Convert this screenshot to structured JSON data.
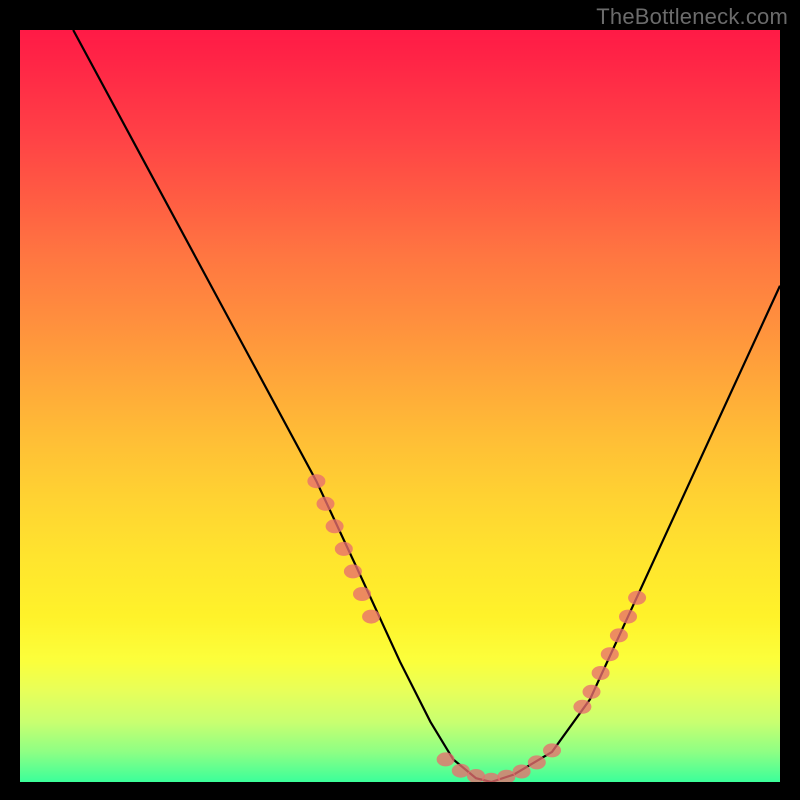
{
  "watermark": "TheBottleneck.com",
  "chart_data": {
    "type": "line",
    "title": "",
    "xlabel": "",
    "ylabel": "",
    "xlim": [
      0,
      100
    ],
    "ylim": [
      0,
      100
    ],
    "series": [
      {
        "name": "curve",
        "x": [
          7,
          15,
          23,
          31,
          39,
          45,
          50,
          54,
          57,
          60,
          62,
          65,
          70,
          75,
          80,
          85,
          90,
          95,
          100
        ],
        "y": [
          100,
          85,
          70,
          55,
          40,
          27,
          16,
          8,
          3,
          0.5,
          0,
          1,
          4,
          11,
          22,
          33,
          44,
          55,
          66
        ]
      },
      {
        "name": "markers-left",
        "x": [
          39,
          40.2,
          41.4,
          42.6,
          43.8,
          45,
          46.2
        ],
        "y": [
          40,
          37,
          34,
          31,
          28,
          25,
          22
        ]
      },
      {
        "name": "markers-bottom",
        "x": [
          56,
          58,
          60,
          62,
          64,
          66,
          68,
          70
        ],
        "y": [
          3,
          1.5,
          0.8,
          0.3,
          0.7,
          1.4,
          2.6,
          4.2
        ]
      },
      {
        "name": "markers-right",
        "x": [
          74,
          75.2,
          76.4,
          77.6,
          78.8,
          80,
          81.2
        ],
        "y": [
          10,
          12,
          14.5,
          17,
          19.5,
          22,
          24.5
        ]
      }
    ],
    "colors": {
      "curve": "#000000",
      "markers": "#e86e6e",
      "gradient_top": "#ff1a46",
      "gradient_mid": "#ffe030",
      "gradient_bottom": "#3bff9a"
    }
  }
}
